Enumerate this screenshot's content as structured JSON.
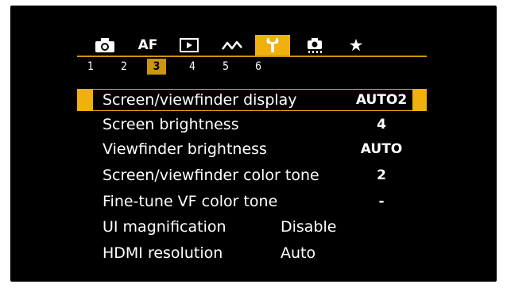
{
  "tabs": [
    {
      "id": "shooting",
      "icon": "camera-icon",
      "text": ""
    },
    {
      "id": "af",
      "icon": "",
      "text": "AF"
    },
    {
      "id": "playback",
      "icon": "play-icon",
      "text": ""
    },
    {
      "id": "wireless",
      "icon": "wireless-icon",
      "text": ""
    },
    {
      "id": "setup",
      "icon": "wrench-icon",
      "text": "",
      "active": true
    },
    {
      "id": "custom",
      "icon": "custom-functions-icon",
      "text": ""
    },
    {
      "id": "mymenu",
      "icon": "star-icon",
      "text": "★"
    }
  ],
  "pages": [
    "1",
    "2",
    "3",
    "4",
    "5",
    "6"
  ],
  "active_page": "3",
  "accent_color": "#f0b00e",
  "menu": [
    {
      "label": "Screen/viewfinder display",
      "value": "AUTO2",
      "selected": true
    },
    {
      "label": "Screen brightness",
      "value": "4"
    },
    {
      "label": "Viewfinder brightness",
      "value": "AUTO"
    },
    {
      "label": "Screen/viewfinder color tone",
      "value": "2"
    },
    {
      "label": "Fine-tune VF color tone",
      "value": "-"
    },
    {
      "label": "UI magnification",
      "value": "Disable"
    },
    {
      "label": "HDMI resolution",
      "value": "Auto"
    }
  ]
}
